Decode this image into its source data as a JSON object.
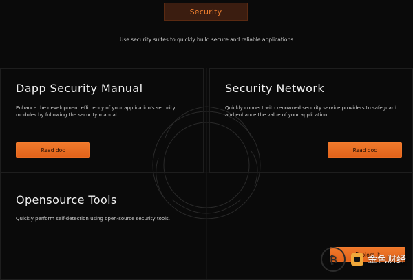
{
  "header": {
    "tab_label": "Security",
    "subtitle": "Use security suites to quickly build secure and reliable applications"
  },
  "cards": [
    {
      "title": "Dapp Security Manual",
      "description": "Enhance the development efficiency of your application's security modules by following the security manual.",
      "button_label": "Read doc"
    },
    {
      "title": "Security Network",
      "description": "Quickly connect with renowned security service providers to safeguard and enhance the value of your application.",
      "button_label": "Read doc"
    },
    {
      "title": "Opensource Tools",
      "description": "Quickly perform self-detection using open-source security tools.",
      "button_label": "Explore it"
    }
  ],
  "watermark": {
    "text": "金色财经",
    "icon": "bitcoin-coin-icon"
  },
  "colors": {
    "accent": "#f07a2c",
    "background": "#0a0a0a"
  }
}
